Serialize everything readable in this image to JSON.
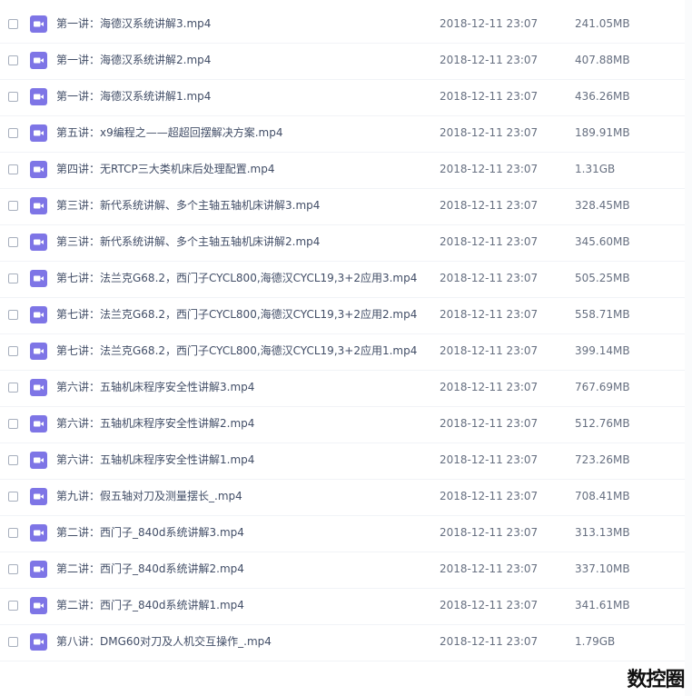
{
  "files": [
    {
      "name": "第一讲：海德汉系统讲解3.mp4",
      "date": "2018-12-11 23:07",
      "size": "241.05MB",
      "icon": "video-file-icon"
    },
    {
      "name": "第一讲：海德汉系统讲解2.mp4",
      "date": "2018-12-11 23:07",
      "size": "407.88MB",
      "icon": "video-file-icon"
    },
    {
      "name": "第一讲：海德汉系统讲解1.mp4",
      "date": "2018-12-11 23:07",
      "size": "436.26MB",
      "icon": "video-file-icon"
    },
    {
      "name": "第五讲：x9编程之——超超回摆解决方案.mp4",
      "date": "2018-12-11 23:07",
      "size": "189.91MB",
      "icon": "video-file-icon"
    },
    {
      "name": "第四讲：无RTCP三大类机床后处理配置.mp4",
      "date": "2018-12-11 23:07",
      "size": "1.31GB",
      "icon": "video-file-icon"
    },
    {
      "name": "第三讲：新代系统讲解、多个主轴五轴机床讲解3.mp4",
      "date": "2018-12-11 23:07",
      "size": "328.45MB",
      "icon": "video-file-icon"
    },
    {
      "name": "第三讲：新代系统讲解、多个主轴五轴机床讲解2.mp4",
      "date": "2018-12-11 23:07",
      "size": "345.60MB",
      "icon": "video-file-icon"
    },
    {
      "name": "第七讲：法兰克G68.2，西门子CYCL800,海德汉CYCL19,3+2应用3.mp4",
      "date": "2018-12-11 23:07",
      "size": "505.25MB",
      "icon": "video-file-icon"
    },
    {
      "name": "第七讲：法兰克G68.2，西门子CYCL800,海德汉CYCL19,3+2应用2.mp4",
      "date": "2018-12-11 23:07",
      "size": "558.71MB",
      "icon": "video-file-icon"
    },
    {
      "name": "第七讲：法兰克G68.2，西门子CYCL800,海德汉CYCL19,3+2应用1.mp4",
      "date": "2018-12-11 23:07",
      "size": "399.14MB",
      "icon": "video-file-icon"
    },
    {
      "name": "第六讲：五轴机床程序安全性讲解3.mp4",
      "date": "2018-12-11 23:07",
      "size": "767.69MB",
      "icon": "video-file-icon"
    },
    {
      "name": "第六讲：五轴机床程序安全性讲解2.mp4",
      "date": "2018-12-11 23:07",
      "size": "512.76MB",
      "icon": "video-file-icon"
    },
    {
      "name": "第六讲：五轴机床程序安全性讲解1.mp4",
      "date": "2018-12-11 23:07",
      "size": "723.26MB",
      "icon": "video-file-icon"
    },
    {
      "name": "第九讲：假五轴对刀及测量摆长_.mp4",
      "date": "2018-12-11 23:07",
      "size": "708.41MB",
      "icon": "video-file-icon"
    },
    {
      "name": "第二讲：西门子_840d系统讲解3.mp4",
      "date": "2018-12-11 23:07",
      "size": "313.13MB",
      "icon": "video-file-icon"
    },
    {
      "name": "第二讲：西门子_840d系统讲解2.mp4",
      "date": "2018-12-11 23:07",
      "size": "337.10MB",
      "icon": "video-file-icon"
    },
    {
      "name": "第二讲：西门子_840d系统讲解1.mp4",
      "date": "2018-12-11 23:07",
      "size": "341.61MB",
      "icon": "video-file-icon"
    },
    {
      "name": "第八讲：DMG60对刀及人机交互操作_.mp4",
      "date": "2018-12-11 23:07",
      "size": "1.79GB",
      "icon": "video-file-icon"
    }
  ],
  "watermark": "数控圈",
  "colors": {
    "icon_bg": "#7e75e6",
    "text": "#424e67",
    "meta_text": "#666f80"
  }
}
